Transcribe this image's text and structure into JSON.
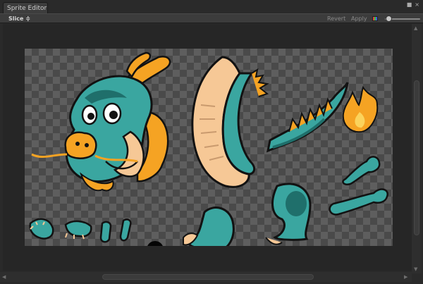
{
  "window": {
    "title": "Sprite Editor",
    "controls": [
      {
        "name": "lock-icon",
        "glyph": "■"
      },
      {
        "name": "close-icon",
        "glyph": "×"
      }
    ]
  },
  "toolbar": {
    "slice_label": "Slice ≑",
    "revert_label": "Revert",
    "apply_label": "Apply",
    "zoom_level": 0.1
  },
  "colors": {
    "window_bg": "#2a2a2a",
    "toolbar_bg": "#3c3c3c",
    "viewport_bg": "#262626",
    "checker_light": "#5e5e5e",
    "checker_dark": "#4a4a4a",
    "dragon_teal": "#3aa6a0",
    "dragon_teal_dark": "#1f6f6b",
    "dragon_cream": "#f6c896",
    "dragon_orange": "#f5a323",
    "outline": "#121212"
  },
  "scrollbars": {
    "vertical": {
      "up_glyph": "▲",
      "down_glyph": "▼"
    },
    "horizontal": {
      "left_glyph": "◀",
      "right_glyph": "▶"
    }
  },
  "sprites": [
    {
      "name": "dragon-head-sprite"
    },
    {
      "name": "dragon-body-curl-sprite"
    },
    {
      "name": "dragon-tail-spine-sprite"
    },
    {
      "name": "flame-sprite"
    },
    {
      "name": "arm-upper-sprite"
    },
    {
      "name": "arm-lower-sprite"
    },
    {
      "name": "leg-crouch-left-sprite"
    },
    {
      "name": "leg-crouch-right-sprite"
    },
    {
      "name": "front-claw-left-sprite"
    },
    {
      "name": "front-claw-right-sprite"
    },
    {
      "name": "toe-left-sprite"
    },
    {
      "name": "toe-right-sprite"
    },
    {
      "name": "black-dot-sprite"
    }
  ]
}
